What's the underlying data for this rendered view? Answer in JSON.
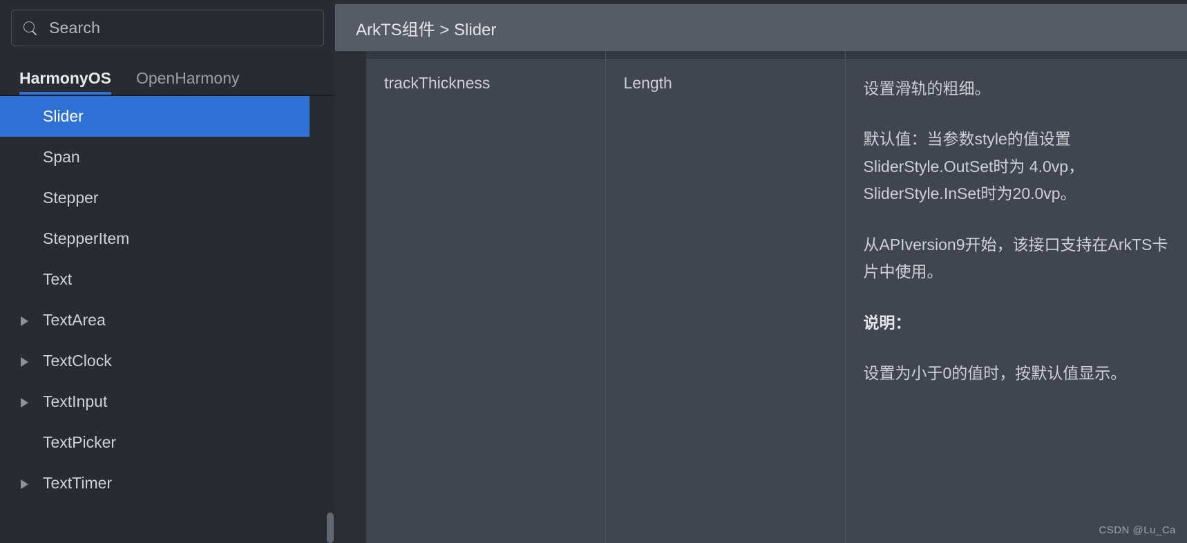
{
  "sidebar": {
    "search": {
      "placeholder": "Search",
      "value": "",
      "icon": "search-icon"
    },
    "tabs": [
      {
        "label": "HarmonyOS",
        "active": true
      },
      {
        "label": "OpenHarmony",
        "active": false
      }
    ],
    "items": [
      {
        "label": "Slider",
        "selected": true,
        "caret": false
      },
      {
        "label": "Span",
        "selected": false,
        "caret": false
      },
      {
        "label": "Stepper",
        "selected": false,
        "caret": false
      },
      {
        "label": "StepperItem",
        "selected": false,
        "caret": false
      },
      {
        "label": "Text",
        "selected": false,
        "caret": false
      },
      {
        "label": "TextArea",
        "selected": false,
        "caret": true
      },
      {
        "label": "TextClock",
        "selected": false,
        "caret": true
      },
      {
        "label": "TextInput",
        "selected": false,
        "caret": true
      },
      {
        "label": "TextPicker",
        "selected": false,
        "caret": false
      },
      {
        "label": "TextTimer",
        "selected": false,
        "caret": true
      }
    ]
  },
  "header": {
    "breadcrumb": "ArkTS组件 > Slider"
  },
  "table": {
    "row": {
      "name": "trackThickness",
      "type": "Length",
      "description": [
        {
          "text": "设置滑轨的粗细。",
          "bold": false
        },
        {
          "text": "默认值：当参数style的值设置SliderStyle.OutSet时为 4.0vp，SliderStyle.InSet时为20.0vp。",
          "bold": false
        },
        {
          "text": "从APIversion9开始，该接口支持在ArkTS卡片中使用。",
          "bold": false
        },
        {
          "text": "说明：",
          "bold": true
        },
        {
          "text": "设置为小于0的值时，按默认值显示。",
          "bold": false
        }
      ]
    }
  },
  "watermark": {
    "text": "CSDN @Lu_Ca"
  },
  "colors": {
    "accent": "#3071d8",
    "sidebar_bg": "#282b31",
    "main_bg": "#2b2e35",
    "header_bg": "#565b66",
    "cell_bg": "#414550",
    "cell_strip": "#343842",
    "border": "#4d515b",
    "text": "#cdd0d6",
    "scrollbar": "#636770"
  }
}
